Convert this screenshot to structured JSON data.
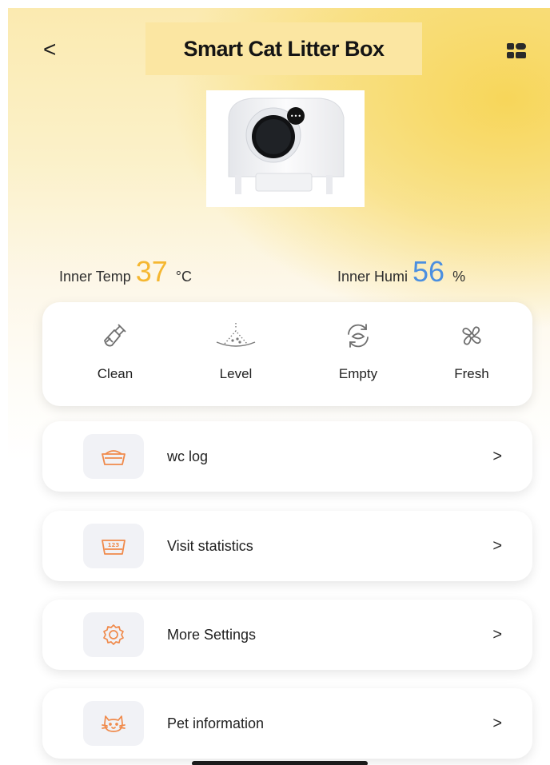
{
  "header": {
    "back_label": "<",
    "title": "Smart Cat Litter Box",
    "menu_icon": "grid-menu-icon"
  },
  "device": {
    "image_icon": "litter-box-device-image",
    "panel_display": "•••"
  },
  "readings": {
    "temp_label": "Inner Temp",
    "temp_value": "37",
    "temp_unit": "°C",
    "temp_color": "#f5b731",
    "humi_label": "Inner Humi",
    "humi_value": "56",
    "humi_unit": "%",
    "humi_color": "#4b8fe0"
  },
  "actions": [
    {
      "label": "Clean",
      "icon": "broom-icon"
    },
    {
      "label": "Level",
      "icon": "level-icon"
    },
    {
      "label": "Empty",
      "icon": "empty-cycle-icon"
    },
    {
      "label": "Fresh",
      "icon": "fan-icon"
    }
  ],
  "menu": [
    {
      "label": "wc log",
      "icon": "litter-tray-icon",
      "chevron": ">"
    },
    {
      "label": "Visit statistics",
      "icon": "stats-tray-icon",
      "chevron": ">"
    },
    {
      "label": "More Settings",
      "icon": "gear-icon",
      "chevron": ">"
    },
    {
      "label": "Pet information",
      "icon": "cat-face-icon",
      "chevron": ">"
    }
  ],
  "colors": {
    "accent_orange": "#f08a4b",
    "icon_gray": "#6f6f6f"
  }
}
